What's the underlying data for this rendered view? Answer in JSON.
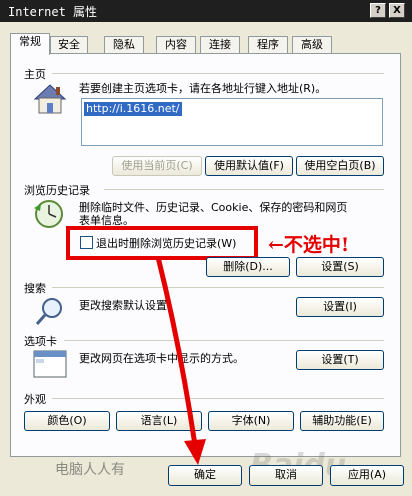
{
  "window": {
    "title": "Internet 属性",
    "help_label": "?",
    "close_label": "X"
  },
  "tabs": [
    "常规",
    "安全",
    "隐私",
    "内容",
    "连接",
    "程序",
    "高级"
  ],
  "home": {
    "title": "主页",
    "description": "若要创建主页选项卡，请在各地址行键入地址(R)。",
    "url": "http://i.1616.net/",
    "btn_current": "使用当前页(C)",
    "btn_default": "使用默认值(F)",
    "btn_blank": "使用空白页(B)"
  },
  "history": {
    "title": "浏览历史记录",
    "description_line1": "删除临时文件、历史记录、Cookie、保存的密码和网页",
    "description_line2": "表单信息。",
    "checkbox_label": "退出时删除浏览历史记录(W)",
    "checkbox_checked": false,
    "btn_delete": "删除(D)...",
    "btn_settings": "设置(S)"
  },
  "search": {
    "title": "搜索",
    "description": "更改搜索默认设置。",
    "btn_settings": "设置(I)"
  },
  "tabs_section": {
    "title": "选项卡",
    "description": "更改网页在选项卡中显示的方式。",
    "btn_settings": "设置(T)"
  },
  "appearance": {
    "title": "外观",
    "btn_colors": "颜色(O)",
    "btn_languages": "语言(L)",
    "btn_fonts": "字体(N)",
    "btn_accessibility": "辅助功能(E)"
  },
  "footer": {
    "btn_ok": "确定",
    "btn_cancel": "取消",
    "btn_apply": "应用(A)"
  },
  "annotation": {
    "text": "←不选中!",
    "watermark": "电脑人人有",
    "watermark2": "Baidu",
    "color": "#e50000"
  }
}
